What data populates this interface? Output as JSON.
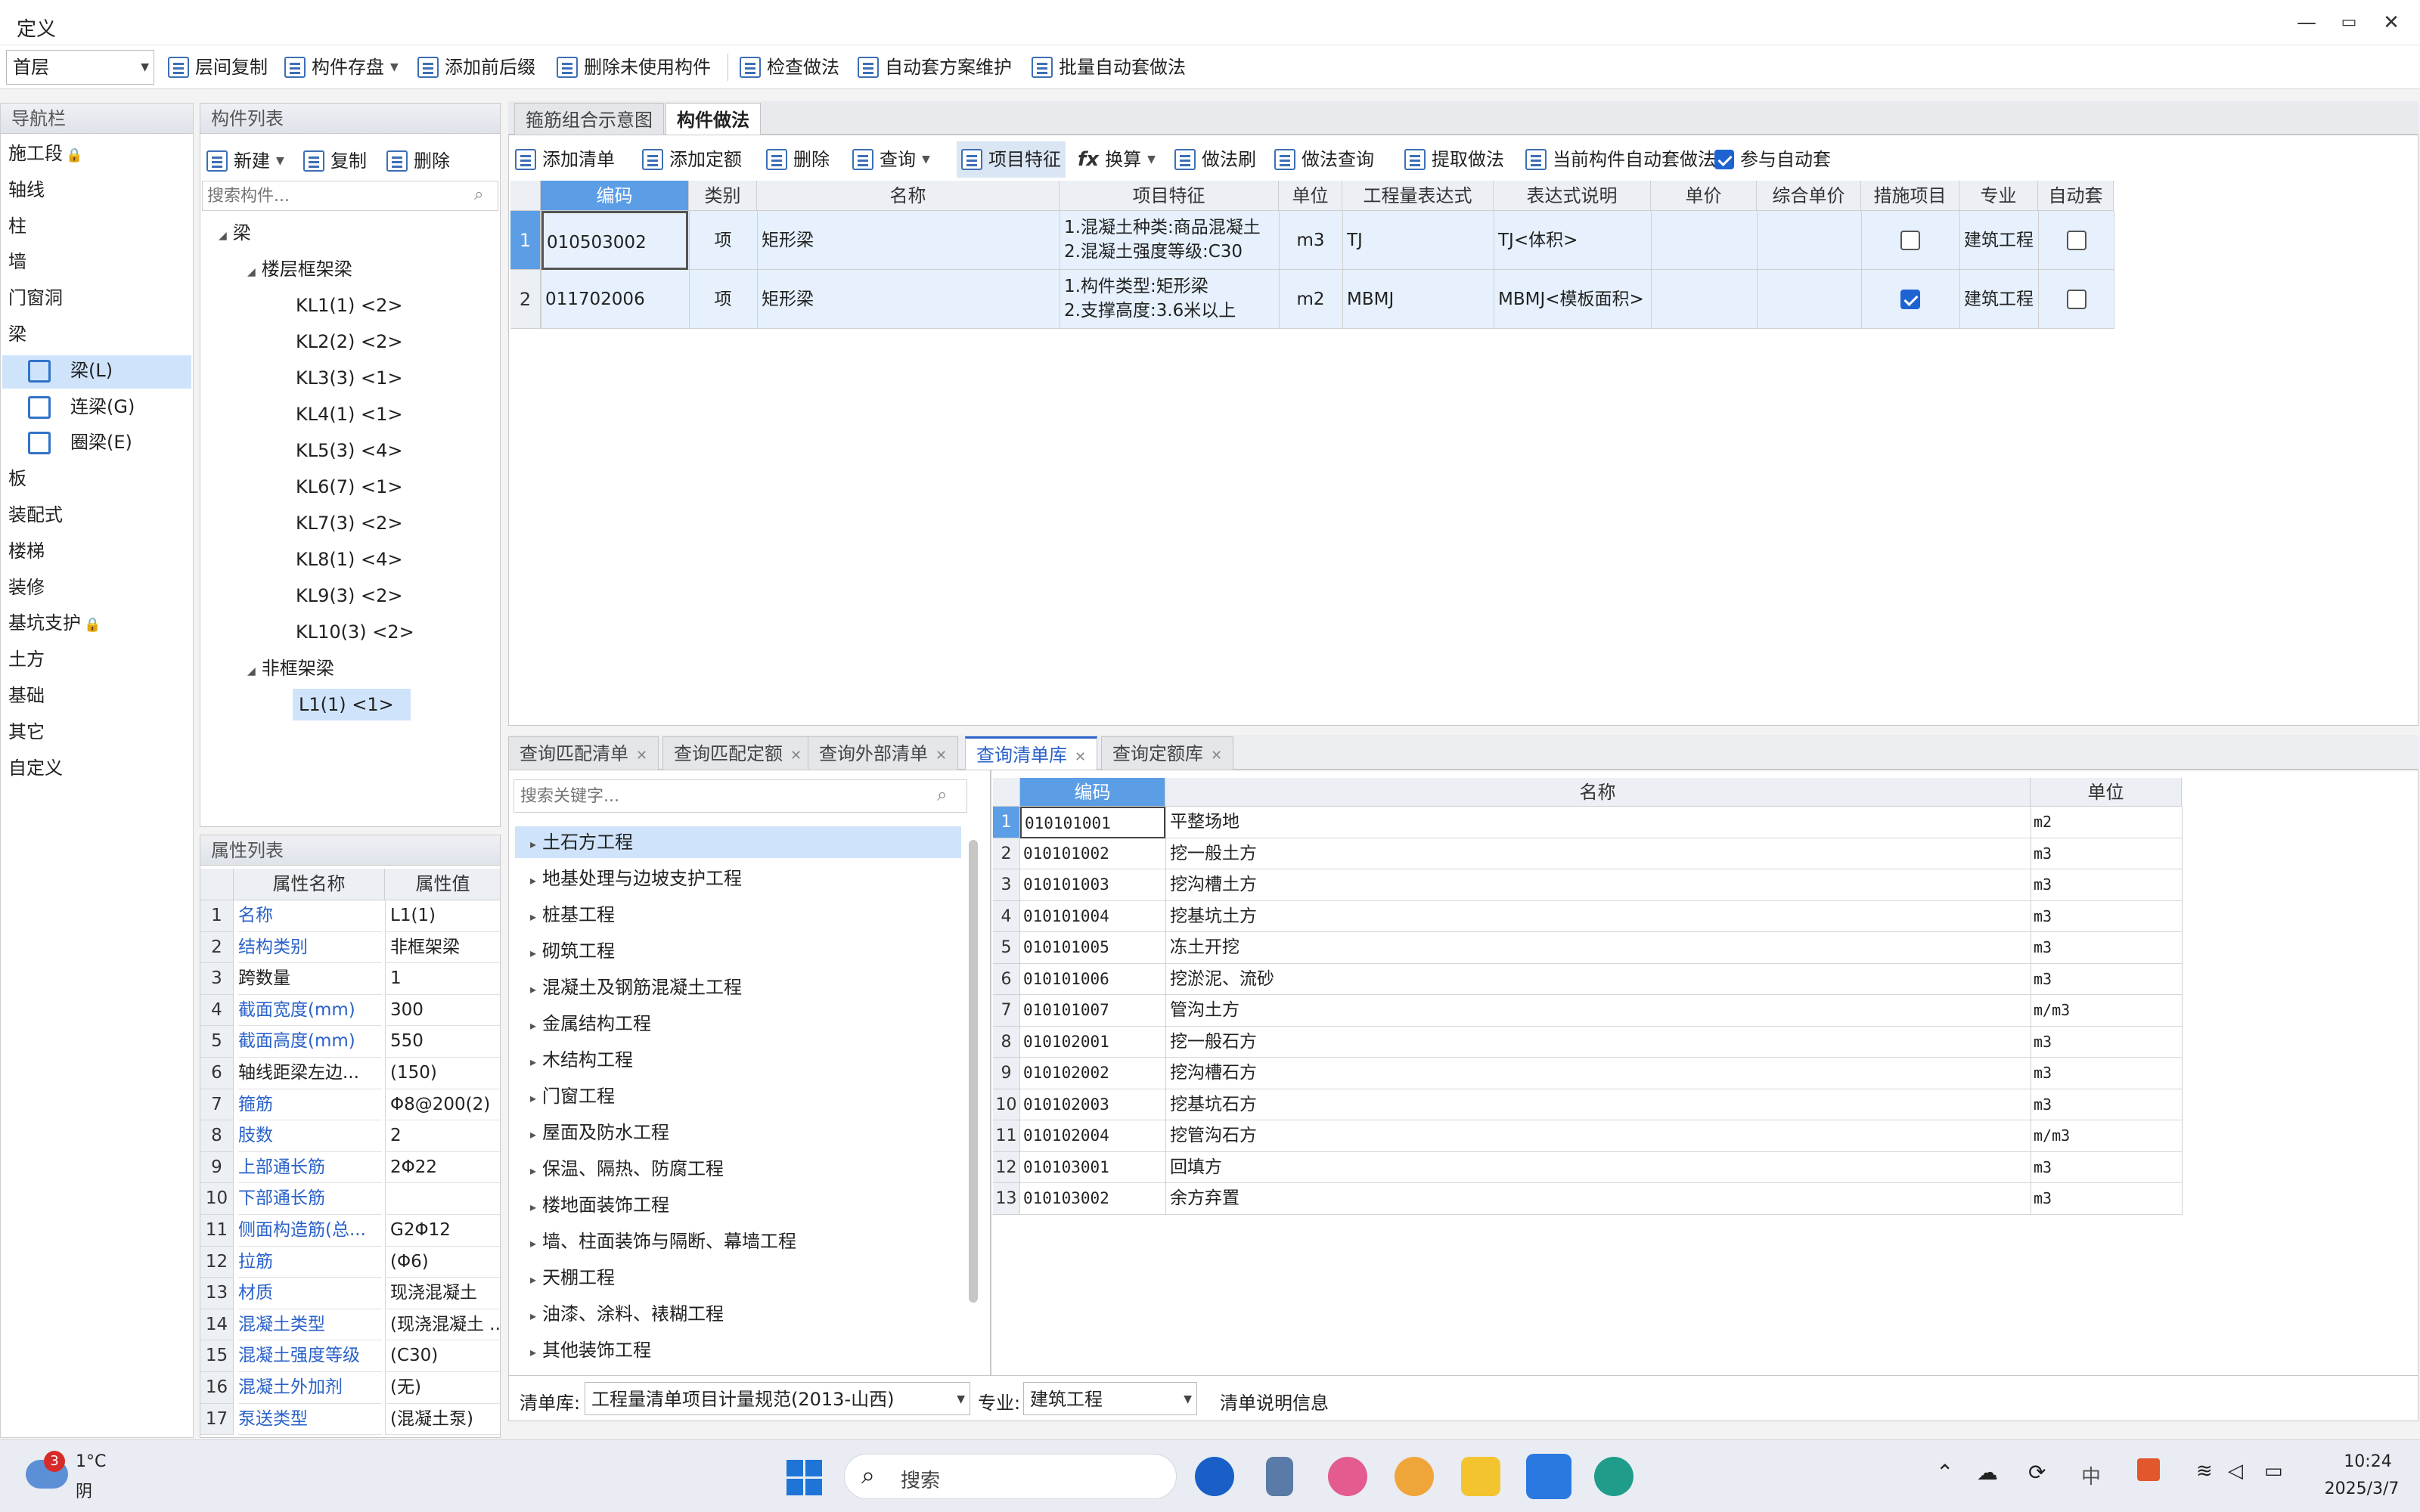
{
  "window": {
    "title": "定义",
    "min": "—",
    "restore": "▭",
    "close": "✕"
  },
  "toolbar": {
    "floor": "首层",
    "buttons": [
      "层间复制",
      "构件存盘",
      "添加前后缀",
      "删除未使用构件",
      "检查做法",
      "自动套方案维护",
      "批量自动套做法"
    ]
  },
  "nav": {
    "title": "导航栏",
    "items": [
      "施工段",
      "轴线",
      "柱",
      "墙",
      "门窗洞",
      "梁",
      "梁(L)",
      "连梁(G)",
      "圈梁(E)",
      "板",
      "装配式",
      "楼梯",
      "装修",
      "基坑支护",
      "土方",
      "基础",
      "其它",
      "自定义"
    ]
  },
  "components": {
    "title": "构件列表",
    "new": "新建",
    "copy": "复制",
    "delete": "删除",
    "search_placeholder": "搜索构件...",
    "root": "梁",
    "group1": "楼层框架梁",
    "frame_beams": [
      "KL1(1) <2>",
      "KL2(2) <2>",
      "KL3(3) <1>",
      "KL4(1) <1>",
      "KL5(3) <4>",
      "KL6(7) <1>",
      "KL7(3) <2>",
      "KL8(1) <4>",
      "KL9(3) <2>",
      "KL10(3) <2>"
    ],
    "group2": "非框架梁",
    "non_frame": [
      "L1(1) <1>"
    ]
  },
  "props": {
    "title": "属性列表",
    "col_name": "属性名称",
    "col_value": "属性值",
    "rows": [
      {
        "n": "1",
        "name": "名称",
        "value": "L1(1)",
        "link": true
      },
      {
        "n": "2",
        "name": "结构类别",
        "value": "非框架梁",
        "link": true
      },
      {
        "n": "3",
        "name": "跨数量",
        "value": "1",
        "link": false
      },
      {
        "n": "4",
        "name": "截面宽度(mm)",
        "value": "300",
        "link": true
      },
      {
        "n": "5",
        "name": "截面高度(mm)",
        "value": "550",
        "link": true
      },
      {
        "n": "6",
        "name": "轴线距梁左边...",
        "value": "(150)",
        "link": false
      },
      {
        "n": "7",
        "name": "箍筋",
        "value": "Φ8@200(2)",
        "link": true
      },
      {
        "n": "8",
        "name": "肢数",
        "value": "2",
        "link": true
      },
      {
        "n": "9",
        "name": "上部通长筋",
        "value": "2Φ22",
        "link": true
      },
      {
        "n": "10",
        "name": "下部通长筋",
        "value": "",
        "link": true
      },
      {
        "n": "11",
        "name": "侧面构造筋(总...",
        "value": "G2Φ12",
        "link": true
      },
      {
        "n": "12",
        "name": "拉筋",
        "value": "(Φ6)",
        "link": true
      },
      {
        "n": "13",
        "name": "材质",
        "value": "现浇混凝土",
        "link": true
      },
      {
        "n": "14",
        "name": "混凝土类型",
        "value": "(现浇混凝土 ..",
        "link": true
      },
      {
        "n": "15",
        "name": "混凝土强度等级",
        "value": "(C30)",
        "link": true
      },
      {
        "n": "16",
        "name": "混凝土外加剂",
        "value": "(无)",
        "link": true
      },
      {
        "n": "17",
        "name": "泵送类型",
        "value": "(混凝土泵)",
        "link": true
      }
    ]
  },
  "main_tabs": [
    "箍筋组合示意图",
    "构件做法"
  ],
  "method_toolbar": [
    "添加清单",
    "添加定额",
    "删除",
    "查询",
    "项目特征",
    "换算",
    "做法刷",
    "做法查询",
    "提取做法",
    "当前构件自动套做法",
    "参与自动套"
  ],
  "method_table": {
    "headers": [
      "编码",
      "类别",
      "名称",
      "项目特征",
      "单位",
      "工程量表达式",
      "表达式说明",
      "单价",
      "综合单价",
      "措施项目",
      "专业",
      "自动套"
    ],
    "rows": [
      {
        "n": "1",
        "code": "010503002",
        "type": "项",
        "name": "矩形梁",
        "feat1": "1.混凝土种类:商品混凝土",
        "feat2": "2.混凝土强度等级:C30",
        "unit": "m3",
        "expr": "TJ",
        "desc": "TJ<体积>",
        "price": "",
        "cprice": "",
        "measure": false,
        "major": "建筑工程",
        "auto": false
      },
      {
        "n": "2",
        "code": "011702006",
        "type": "项",
        "name": "矩形梁",
        "feat1": "1.构件类型:矩形梁",
        "feat2": "2.支撑高度:3.6米以上",
        "unit": "m2",
        "expr": "MBMJ",
        "desc": "MBMJ<模板面积>",
        "price": "",
        "cprice": "",
        "measure": true,
        "major": "建筑工程",
        "auto": false
      }
    ]
  },
  "query_tabs": [
    "查询匹配清单",
    "查询匹配定额",
    "查询外部清单",
    "查询清单库",
    "查询定额库"
  ],
  "library": {
    "search_placeholder": "搜索关键字...",
    "categories": [
      "土石方工程",
      "地基处理与边坡支护工程",
      "桩基工程",
      "砌筑工程",
      "混凝土及钢筋混凝土工程",
      "金属结构工程",
      "木结构工程",
      "门窗工程",
      "屋面及防水工程",
      "保温、隔热、防腐工程",
      "楼地面装饰工程",
      "墙、柱面装饰与隔断、幕墙工程",
      "天棚工程",
      "油漆、涂料、裱糊工程",
      "其他装饰工程"
    ],
    "headers": [
      "编码",
      "名称",
      "单位"
    ],
    "rows": [
      {
        "n": "1",
        "code": "010101001",
        "name": "平整场地",
        "unit": "m2"
      },
      {
        "n": "2",
        "code": "010101002",
        "name": "挖一般土方",
        "unit": "m3"
      },
      {
        "n": "3",
        "code": "010101003",
        "name": "挖沟槽土方",
        "unit": "m3"
      },
      {
        "n": "4",
        "code": "010101004",
        "name": "挖基坑土方",
        "unit": "m3"
      },
      {
        "n": "5",
        "code": "010101005",
        "name": "冻土开挖",
        "unit": "m3"
      },
      {
        "n": "6",
        "code": "010101006",
        "name": "挖淤泥、流砂",
        "unit": "m3"
      },
      {
        "n": "7",
        "code": "010101007",
        "name": "管沟土方",
        "unit": "m/m3"
      },
      {
        "n": "8",
        "code": "010102001",
        "name": "挖一般石方",
        "unit": "m3"
      },
      {
        "n": "9",
        "code": "010102002",
        "name": "挖沟槽石方",
        "unit": "m3"
      },
      {
        "n": "10",
        "code": "010102003",
        "name": "挖基坑石方",
        "unit": "m3"
      },
      {
        "n": "11",
        "code": "010102004",
        "name": "挖管沟石方",
        "unit": "m/m3"
      },
      {
        "n": "12",
        "code": "010103001",
        "name": "回填方",
        "unit": "m3"
      },
      {
        "n": "13",
        "code": "010103002",
        "name": "余方弃置",
        "unit": "m3"
      }
    ],
    "footer_label": "清单库:",
    "footer_lib": "工程量清单项目计量规范(2013-山西)",
    "footer_major_label": "专业:",
    "footer_major": "建筑工程",
    "footer_info": "清单说明信息"
  },
  "taskbar": {
    "weather_temp": "1°C",
    "weather_desc": "阴",
    "weather_badge": "3",
    "search": "搜索",
    "time": "10:24",
    "date": "2025/3/7",
    "ime": "中"
  }
}
